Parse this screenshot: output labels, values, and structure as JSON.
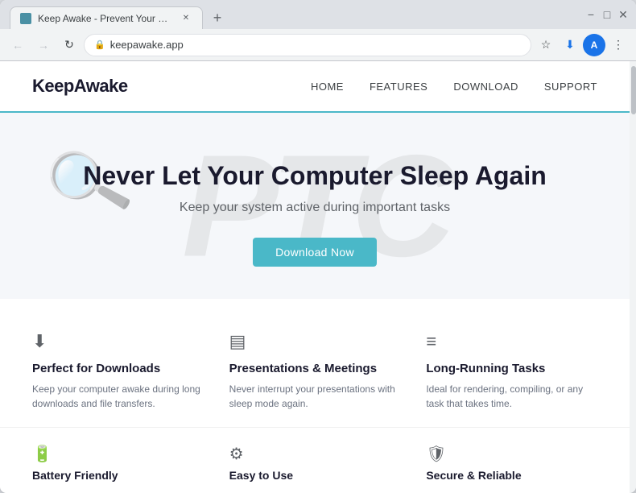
{
  "browser": {
    "tab_title": "Keep Awake - Prevent Your Co...",
    "url": "keepawake.app",
    "new_tab_symbol": "+",
    "minimize_symbol": "−",
    "maximize_symbol": "□",
    "close_symbol": "✕",
    "back_symbol": "←",
    "forward_symbol": "→",
    "refresh_symbol": "↻",
    "tab_close_symbol": "✕",
    "star_symbol": "☆",
    "menu_symbol": "⋮"
  },
  "site": {
    "logo": "KeepAwake",
    "nav": {
      "home": "HOME",
      "features": "FEATURES",
      "download": "DOWNLOAD",
      "support": "SUPPORT"
    },
    "hero": {
      "title": "Never Let Your Computer Sleep Again",
      "subtitle": "Keep your system active during important tasks",
      "cta_button": "Download Now",
      "watermark": "PTC"
    },
    "features": [
      {
        "icon": "⬇",
        "title": "Perfect for Downloads",
        "desc": "Keep your computer awake during long downloads and file transfers."
      },
      {
        "icon": "▤",
        "title": "Presentations & Meetings",
        "desc": "Never interrupt your presentations with sleep mode again."
      },
      {
        "icon": "≡",
        "title": "Long-Running Tasks",
        "desc": "Ideal for rendering, compiling, or any task that takes time."
      }
    ],
    "bottom_features": [
      {
        "icon": "🔋",
        "title": "Battery Friendly"
      },
      {
        "icon": "⚙",
        "title": "Easy to Use"
      },
      {
        "icon": "🛡",
        "title": "Secure & Reliable"
      }
    ]
  },
  "colors": {
    "accent": "#4ab8c8",
    "logo_color": "#1a1a2e",
    "nav_text": "#3c4043",
    "hero_bg": "#f5f7fa",
    "feature_icon": "#5f6368",
    "watermark": "rgba(200,200,200,0.35)"
  }
}
